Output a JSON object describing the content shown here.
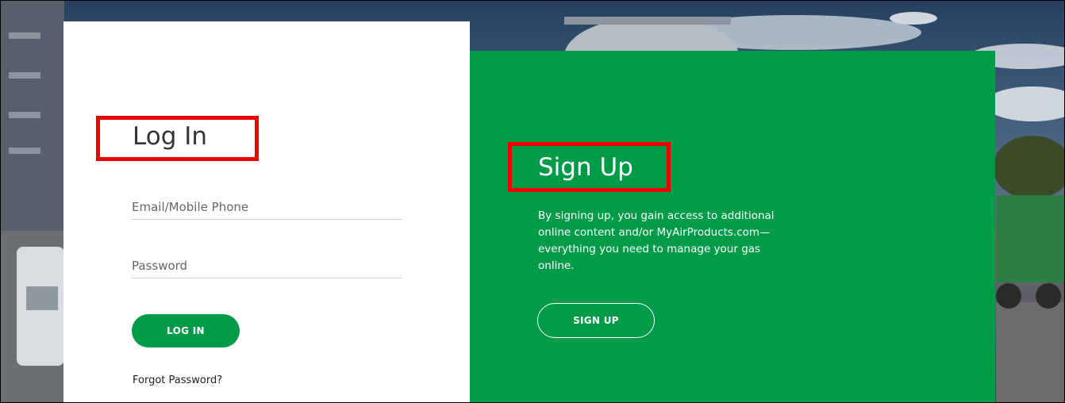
{
  "login": {
    "title": "Log In",
    "email_placeholder": "Email/Mobile Phone",
    "password_placeholder": "Password",
    "button_label": "LOG IN",
    "forgot_label": "Forgot Password?"
  },
  "signup": {
    "title": "Sign Up",
    "description": "By signing up, you gain access to additional online content and/or MyAirProducts.com—everything you need to manage your gas online.",
    "button_label": "SIGN UP"
  },
  "colors": {
    "brand_green": "#009b48",
    "highlight_red": "#ee0000"
  }
}
